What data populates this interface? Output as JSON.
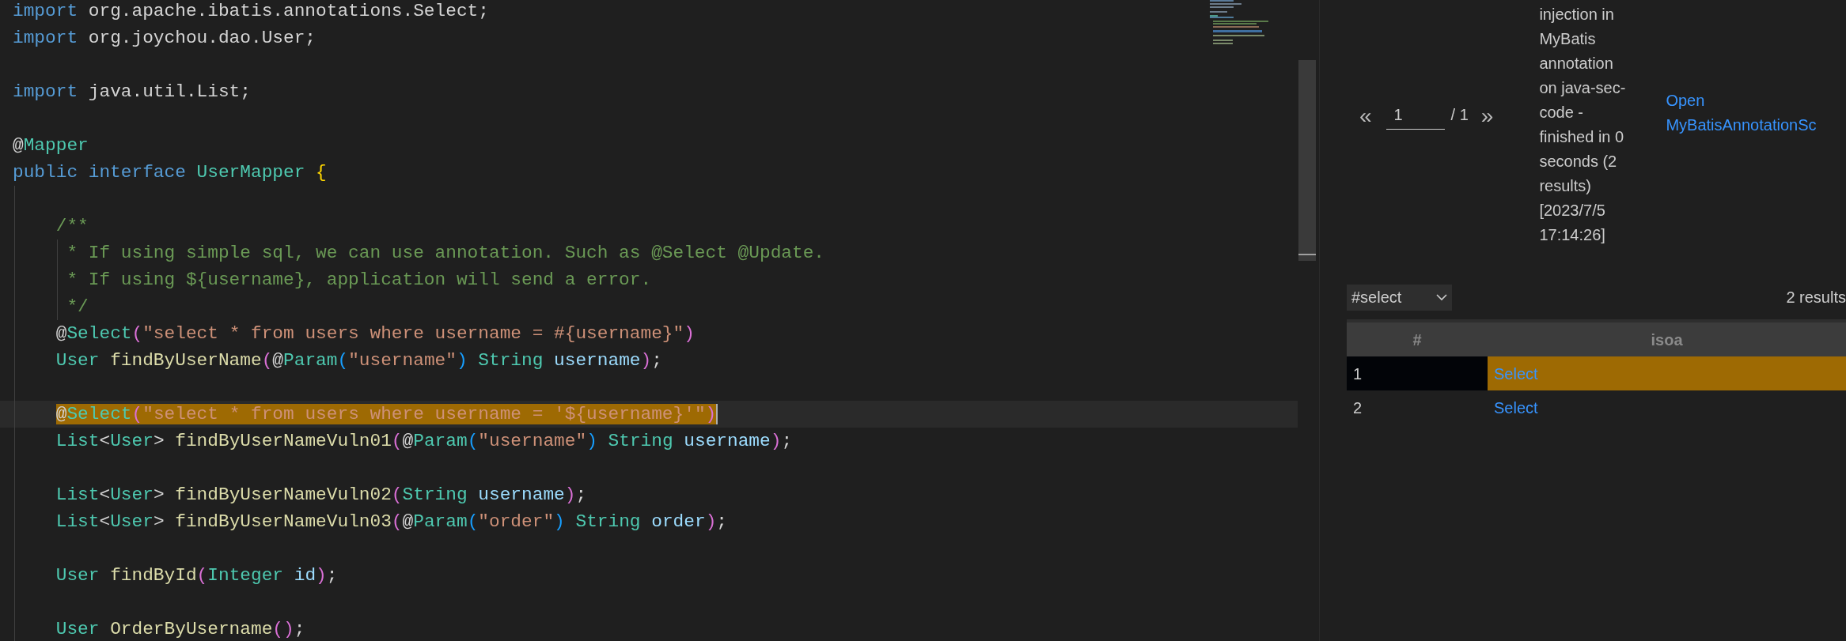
{
  "editor": {
    "lines": [
      {
        "selected": false,
        "tokens": [
          {
            "kind": "keyword",
            "text": "import "
          },
          {
            "kind": "plain",
            "text": "org.apache.ibatis.annotations.Select;"
          }
        ]
      },
      {
        "selected": false,
        "tokens": [
          {
            "kind": "keyword",
            "text": "import "
          },
          {
            "kind": "plain",
            "text": "org.joychou.dao.User;"
          }
        ]
      },
      {
        "selected": false
      },
      {
        "selected": false,
        "tokens": [
          {
            "kind": "keyword",
            "text": "import "
          },
          {
            "kind": "plain",
            "text": "java.util.List;"
          }
        ]
      },
      {
        "selected": false
      },
      {
        "selected": false,
        "tokens": [
          {
            "kind": "plain",
            "text": "@"
          },
          {
            "kind": "type",
            "text": "Mapper"
          }
        ]
      },
      {
        "selected": false,
        "tokens": [
          {
            "kind": "keyword",
            "text": "public interface "
          },
          {
            "kind": "type",
            "text": "UserMapper "
          },
          {
            "kind": "bracket1",
            "text": "{"
          }
        ]
      },
      {
        "selected": false
      },
      {
        "selected": false,
        "tokens": [
          {
            "kind": "comment",
            "text": "    /**"
          }
        ]
      },
      {
        "selected": false,
        "tokens": [
          {
            "kind": "comment",
            "text": "     * If using simple sql, we can use annotation. Such as @Select @Update."
          }
        ]
      },
      {
        "selected": false,
        "tokens": [
          {
            "kind": "comment",
            "text": "     * If using ${username}, application will send a error."
          }
        ]
      },
      {
        "selected": false,
        "tokens": [
          {
            "kind": "comment",
            "text": "     */"
          }
        ]
      },
      {
        "selected": false,
        "tokens": [
          {
            "kind": "plain",
            "text": "    @"
          },
          {
            "kind": "type",
            "text": "Select"
          },
          {
            "kind": "bracket2",
            "text": "("
          },
          {
            "kind": "string",
            "text": "\"select * from users where username = #{username}\""
          },
          {
            "kind": "bracket2",
            "text": ")"
          }
        ]
      },
      {
        "selected": false,
        "tokens": [
          {
            "kind": "type",
            "text": "    User "
          },
          {
            "kind": "func",
            "text": "findByUserName"
          },
          {
            "kind": "bracket2",
            "text": "("
          },
          {
            "kind": "plain",
            "text": "@"
          },
          {
            "kind": "type",
            "text": "Param"
          },
          {
            "kind": "bracket3",
            "text": "("
          },
          {
            "kind": "string",
            "text": "\"username\""
          },
          {
            "kind": "bracket3",
            "text": ") "
          },
          {
            "kind": "type",
            "text": "String "
          },
          {
            "kind": "param",
            "text": "username"
          },
          {
            "kind": "bracket2",
            "text": ")"
          },
          {
            "kind": "plain",
            "text": ";"
          }
        ]
      },
      {
        "selected": false
      },
      {
        "selected": true,
        "tokens": [
          {
            "kind": "plain",
            "text": "    @"
          },
          {
            "kind": "type",
            "text": "Select"
          },
          {
            "kind": "bracket2",
            "text": "("
          },
          {
            "kind": "string",
            "text": "\"select * from users where username = '${username}'\""
          },
          {
            "kind": "bracket2",
            "text": ")"
          }
        ]
      },
      {
        "selected": false,
        "tokens": [
          {
            "kind": "type",
            "text": "    List"
          },
          {
            "kind": "plain",
            "text": "<"
          },
          {
            "kind": "type",
            "text": "User"
          },
          {
            "kind": "plain",
            "text": "> "
          },
          {
            "kind": "func",
            "text": "findByUserNameVuln01"
          },
          {
            "kind": "bracket2",
            "text": "("
          },
          {
            "kind": "plain",
            "text": "@"
          },
          {
            "kind": "type",
            "text": "Param"
          },
          {
            "kind": "bracket3",
            "text": "("
          },
          {
            "kind": "string",
            "text": "\"username\""
          },
          {
            "kind": "bracket3",
            "text": ") "
          },
          {
            "kind": "type",
            "text": "String "
          },
          {
            "kind": "param",
            "text": "username"
          },
          {
            "kind": "bracket2",
            "text": ")"
          },
          {
            "kind": "plain",
            "text": ";"
          }
        ]
      },
      {
        "selected": false
      },
      {
        "selected": false,
        "tokens": [
          {
            "kind": "type",
            "text": "    List"
          },
          {
            "kind": "plain",
            "text": "<"
          },
          {
            "kind": "type",
            "text": "User"
          },
          {
            "kind": "plain",
            "text": "> "
          },
          {
            "kind": "func",
            "text": "findByUserNameVuln02"
          },
          {
            "kind": "bracket2",
            "text": "("
          },
          {
            "kind": "type",
            "text": "String "
          },
          {
            "kind": "param",
            "text": "username"
          },
          {
            "kind": "bracket2",
            "text": ")"
          },
          {
            "kind": "plain",
            "text": ";"
          }
        ]
      },
      {
        "selected": false,
        "tokens": [
          {
            "kind": "type",
            "text": "    List"
          },
          {
            "kind": "plain",
            "text": "<"
          },
          {
            "kind": "type",
            "text": "User"
          },
          {
            "kind": "plain",
            "text": "> "
          },
          {
            "kind": "func",
            "text": "findByUserNameVuln03"
          },
          {
            "kind": "bracket2",
            "text": "("
          },
          {
            "kind": "plain",
            "text": "@"
          },
          {
            "kind": "type",
            "text": "Param"
          },
          {
            "kind": "bracket3",
            "text": "("
          },
          {
            "kind": "string",
            "text": "\"order\""
          },
          {
            "kind": "bracket3",
            "text": ") "
          },
          {
            "kind": "type",
            "text": "String "
          },
          {
            "kind": "param",
            "text": "order"
          },
          {
            "kind": "bracket2",
            "text": ")"
          },
          {
            "kind": "plain",
            "text": ";"
          }
        ]
      },
      {
        "selected": false
      },
      {
        "selected": false,
        "tokens": [
          {
            "kind": "type",
            "text": "    User "
          },
          {
            "kind": "func",
            "text": "findById"
          },
          {
            "kind": "bracket2",
            "text": "("
          },
          {
            "kind": "type",
            "text": "Integer "
          },
          {
            "kind": "param",
            "text": "id"
          },
          {
            "kind": "bracket2",
            "text": ")"
          },
          {
            "kind": "plain",
            "text": ";"
          }
        ]
      },
      {
        "selected": false
      },
      {
        "selected": false,
        "tokens": [
          {
            "kind": "type",
            "text": "    User "
          },
          {
            "kind": "func",
            "text": "OrderByUsername"
          },
          {
            "kind": "bracket2",
            "text": "()"
          },
          {
            "kind": "plain",
            "text": ";"
          }
        ]
      }
    ]
  },
  "results_panel": {
    "pagination": {
      "previous": "«",
      "page": "1",
      "total": "/ 1",
      "next": "»"
    },
    "message": "injection in MyBatis annotation on java-sec-code - finished in 0 seconds (2 results) [2023/7/5 17:14:26]",
    "open_link": "Open MyBatisAnnotationSc",
    "result_set": "#select",
    "result_count": "2 results",
    "table": {
      "columns": [
        "#",
        "isoa"
      ],
      "rows": [
        {
          "selected": true,
          "cells": [
            "1",
            "Select"
          ]
        },
        {
          "selected": false,
          "cells": [
            "2",
            "Select"
          ]
        }
      ]
    }
  }
}
